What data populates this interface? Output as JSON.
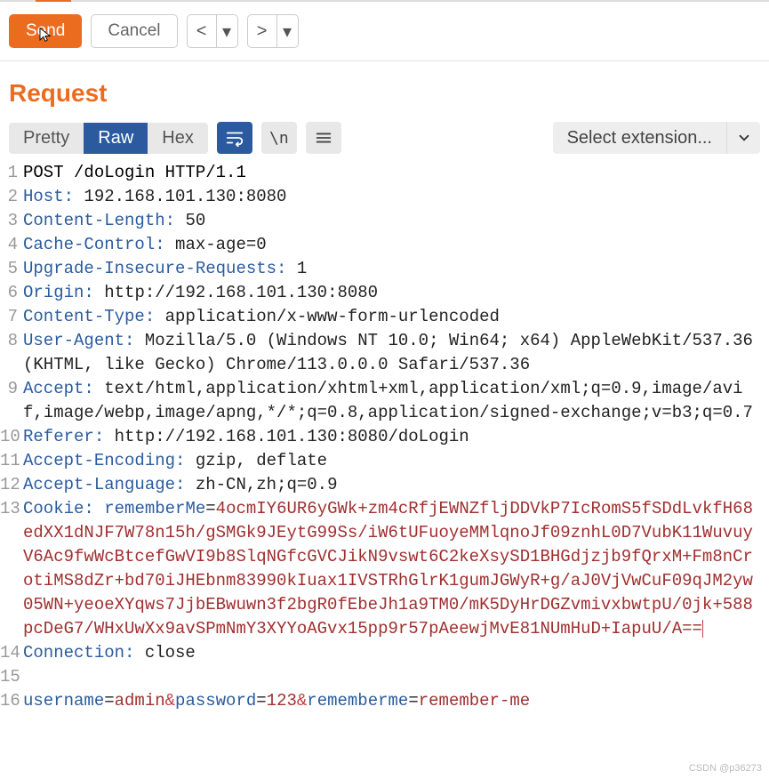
{
  "toolbar": {
    "send_label": "Send",
    "cancel_label": "Cancel"
  },
  "section": {
    "title": "Request"
  },
  "tabs": {
    "pretty": "Pretty",
    "raw": "Raw",
    "hex": "Hex",
    "newline_label": "\\n"
  },
  "extension": {
    "label": "Select extension..."
  },
  "http": {
    "request_line": "POST /doLogin HTTP/1.1",
    "headers": [
      {
        "n": 2,
        "k": "Host",
        "v": "192.168.101.130:8080"
      },
      {
        "n": 3,
        "k": "Content-Length",
        "v": "50"
      },
      {
        "n": 4,
        "k": "Cache-Control",
        "v": "max-age=0"
      },
      {
        "n": 5,
        "k": "Upgrade-Insecure-Requests",
        "v": "1"
      },
      {
        "n": 6,
        "k": "Origin",
        "v": "http://192.168.101.130:8080"
      },
      {
        "n": 7,
        "k": "Content-Type",
        "v": "application/x-www-form-urlencoded"
      },
      {
        "n": 8,
        "k": "User-Agent",
        "v": "Mozilla/5.0 (Windows NT 10.0; Win64; x64) AppleWebKit/537.36 (KHTML, like Gecko) Chrome/113.0.0.0 Safari/537.36"
      },
      {
        "n": 9,
        "k": "Accept",
        "v": "text/html,application/xhtml+xml,application/xml;q=0.9,image/avif,image/webp,image/apng,*/*;q=0.8,application/signed-exchange;v=b3;q=0.7"
      },
      {
        "n": 10,
        "k": "Referer",
        "v": "http://192.168.101.130:8080/doLogin"
      },
      {
        "n": 11,
        "k": "Accept-Encoding",
        "v": "gzip, deflate"
      },
      {
        "n": 12,
        "k": "Accept-Language",
        "v": "zh-CN,zh;q=0.9"
      }
    ],
    "cookie": {
      "n": 13,
      "k": "Cookie",
      "name": "rememberMe",
      "value": "4ocmIY6UR6yGWk+zm4cRfjEWNZfljDDVkP7IcRomS5fSDdLvkfH68edXX1dNJF7W78n15h/gSMGk9JEytG99Ss/iW6tUFuoyeMMlqnoJf09znhL0D7VubK11WuvuyV6Ac9fwWcBtcefGwVI9b8SlqNGfcGVCJikN9vswt6C2keXsySD1BHGdjzjb9fQrxM+Fm8nCrotiMS8dZr+bd70iJHEbnm83990kIuax1IVSTRhGlrK1gumJGWyR+g/aJ0VjVwCuF09qJM2yw05WN+yeoeXYqws7JjbEBwuwn3f2bgR0fEbeJh1a9TM0/mK5DyHrDGZvmivxbwtpU/0jk+588pcDeG7/WHxUwXx9avSPmNmY3XYYoAGvx15pp9r57pAeewjMvE81NUmHuD+IapuU/A=="
    },
    "connection": {
      "n": 14,
      "k": "Connection",
      "v": "close"
    },
    "body": {
      "n": 16,
      "params": [
        {
          "k": "username",
          "v": "admin"
        },
        {
          "k": "password",
          "v": "123"
        },
        {
          "k": "rememberme",
          "v": "remember-me"
        }
      ]
    }
  },
  "watermark": "CSDN @p36273"
}
